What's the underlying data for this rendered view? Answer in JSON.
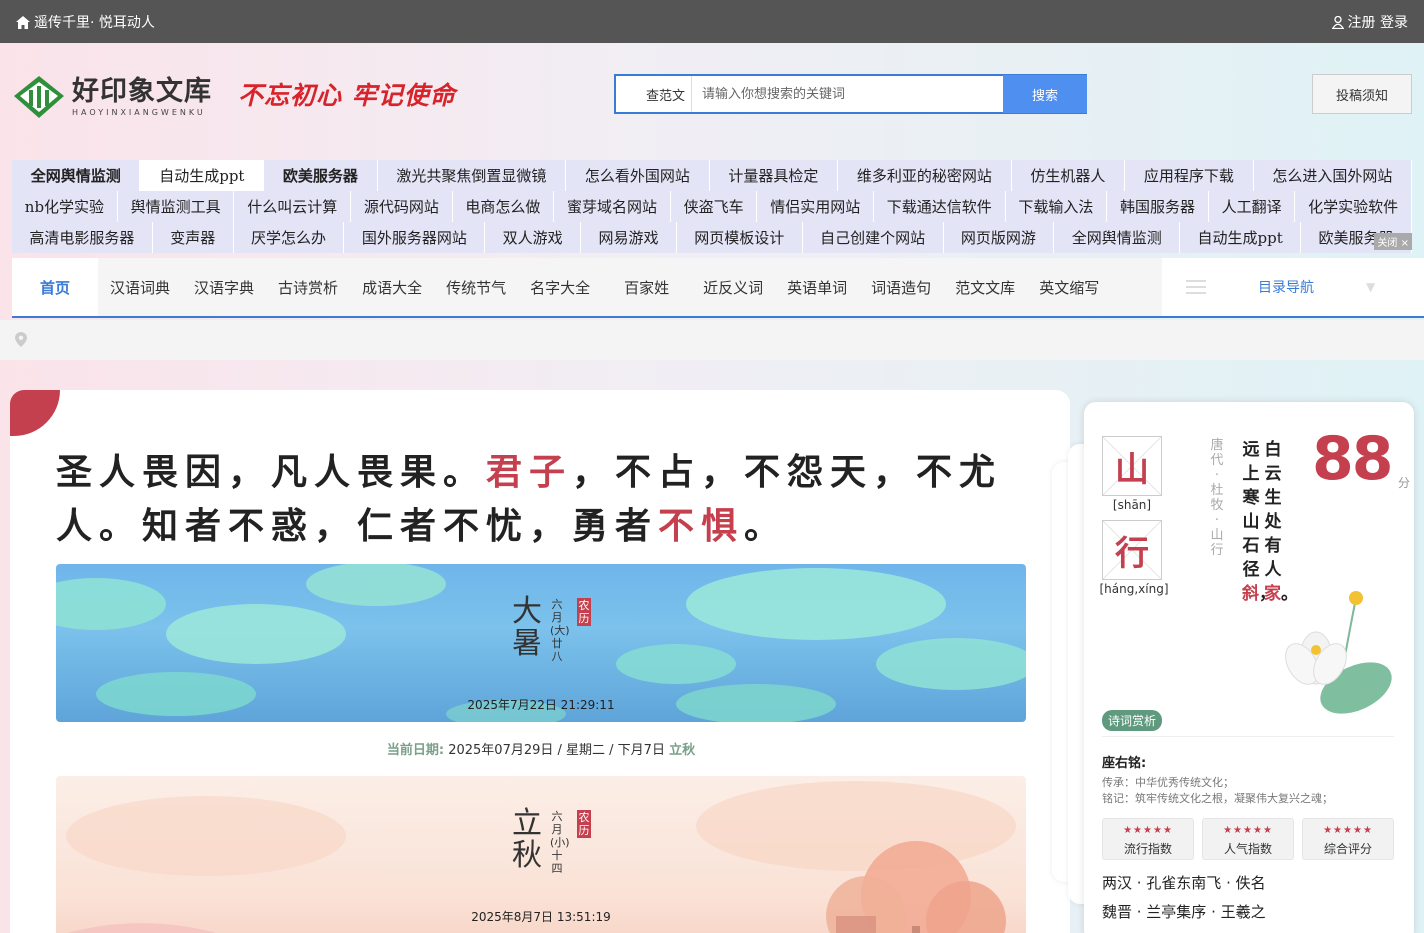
{
  "topbar": {
    "left_text": "遥传千里· 悦耳动人",
    "right_text": "注册 登录"
  },
  "logo": {
    "title": "好印象文库",
    "subtitle": "HAOYINXIANGWENKU"
  },
  "slogan": "不忘初心 牢记使命",
  "search": {
    "type_label": "查范文",
    "placeholder": "请输入你想搜索的关键词",
    "button": "搜索"
  },
  "contribute": "投稿须知",
  "link_rows": [
    [
      "全网舆情监测",
      "自动生成ppt",
      "欧美服务器",
      "激光共聚焦倒置显微镜",
      "怎么看外国网站",
      "计量器具检定",
      "维多利亚的秘密网站",
      "仿生机器人",
      "应用程序下载",
      "怎么进入国外网站"
    ],
    [
      "nb化学实验",
      "舆情监测工具",
      "什么叫云计算",
      "源代码网站",
      "电商怎么做",
      "蜜芽域名网站",
      "侠盗飞车",
      "情侣实用网站",
      "下载通达信软件",
      "下载输入法",
      "韩国服务器",
      "人工翻译",
      "化学实验软件"
    ],
    [
      "高清电影服务器",
      "变声器",
      "厌学怎么办",
      "国外服务器网站",
      "双人游戏",
      "网易游戏",
      "网页模板设计",
      "自己创建个网站",
      "网页版网游",
      "全网舆情监测",
      "自动生成ppt",
      "欧美服务器"
    ]
  ],
  "ad_close": "关闭 ×",
  "nav": {
    "items": [
      "首页",
      "汉语词典",
      "汉语字典",
      "古诗赏析",
      "成语大全",
      "传统节气",
      "名字大全",
      "百家姓",
      "近反义词",
      "英语单词",
      "词语造句",
      "范文文库",
      "英文缩写"
    ],
    "catalog": "目录导航"
  },
  "quote": {
    "p1": "圣人畏因，凡人畏果。",
    "r1": "君子",
    "p2": "，不占，不怨天，不尤人。知者不惑，仁者不忧，勇者",
    "r2": "不惧",
    "p3": "。"
  },
  "terms": [
    {
      "name": "大暑",
      "lunar": "六月(大)廿八",
      "tag": "农历",
      "stamp": "2025年7月22日 21:29:11"
    },
    {
      "name": "立秋",
      "lunar": "六月(小)十四",
      "tag": "农历",
      "stamp": "2025年8月7日 13:51:19"
    }
  ],
  "current_date": {
    "label": "当前日期:",
    "value": "2025年07月29日 / 星期二 / 下月7日",
    "term": "立秋"
  },
  "poem_card": {
    "chars": [
      {
        "char": "山",
        "pinyin": "[shān]"
      },
      {
        "char": "行",
        "pinyin": "[háng,xíng]"
      }
    ],
    "author": "唐代·杜牧·山行",
    "col1": "远上寒山石径",
    "col1_red": "斜",
    "col1_end": "，",
    "col2": "白云生处有人",
    "col2_red": "家",
    "col2_end": "。",
    "score": "88",
    "score_unit": "分",
    "tag": "诗词赏析",
    "motto_title": "座右铭:",
    "motto_lines": [
      "传承：中华优秀传统文化；",
      "铭记：筑牢传统文化之根，凝聚伟大复兴之魂；"
    ],
    "ratings": [
      {
        "stars": "★★★★★",
        "label": "流行指数"
      },
      {
        "stars": "★★★★★",
        "label": "人气指数"
      },
      {
        "stars": "★★★★★",
        "label": "综合评分"
      }
    ],
    "poem_list": [
      "两汉 · 孔雀东南飞 · 佚名",
      "魏晋 · 兰亭集序 · 王羲之"
    ]
  },
  "colors": {
    "accent_blue": "#3a7bd5",
    "accent_red": "#c5404e",
    "green": "#5f9a7f"
  }
}
